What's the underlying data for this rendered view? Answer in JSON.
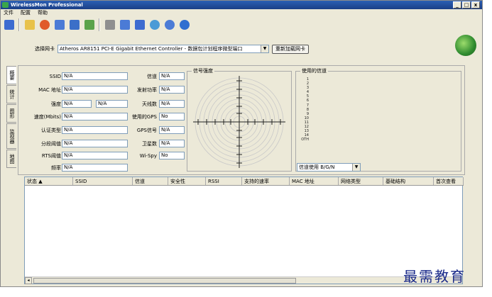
{
  "window": {
    "title": "WirelessMon Professional",
    "btn_min": "_",
    "btn_max": "□",
    "btn_close": "x"
  },
  "menu": [
    "文件",
    "配置",
    "帮助"
  ],
  "toolbar": {
    "icons": [
      "save-icon",
      "open-folder-icon",
      "record-icon",
      "network-icon",
      "log-icon",
      "export-icon",
      "print-icon",
      "chart-icon",
      "info-icon",
      "globe-icon",
      "refresh-icon",
      "help-icon"
    ],
    "colors": [
      "#3d6bd0",
      "#e8c24a",
      "#e05a2a",
      "#4b7bd6",
      "#3b6fc8",
      "#5aa34a",
      "#8f8f8f",
      "#4b7bd6",
      "#3d6bd0",
      "#4b9bd6",
      "#4b7bd6",
      "#2f6fd0"
    ]
  },
  "adapter": {
    "label": "选择网卡",
    "value": "Atheros AR8151 PCI-E Gigabit Ethernet Controller - 数据包计划程序微型端口",
    "reload": "重新加载网卡"
  },
  "tabs": [
    "概要",
    "统计",
    "图形",
    "监视器",
    "地图"
  ],
  "fields_left": [
    {
      "label": "SSID",
      "value": "N/A"
    },
    {
      "label": "MAC 地址",
      "value": "N/A"
    },
    {
      "label": "强度",
      "value": "N/A",
      "value2": "N/A"
    },
    {
      "label": "速度(Mbits)",
      "value": "N/A"
    },
    {
      "label": "认证类型",
      "value": "N/A"
    },
    {
      "label": "分段阈值",
      "value": "N/A"
    },
    {
      "label": "RTS阈值",
      "value": "N/A"
    },
    {
      "label": "频率",
      "value": "N/A"
    }
  ],
  "fields_mid": [
    {
      "label": "信道",
      "value": "N/A"
    },
    {
      "label": "发射功率",
      "value": "N/A"
    },
    {
      "label": "天线数",
      "value": "N/A"
    },
    {
      "label": "使用的GPS",
      "value": "No"
    },
    {
      "label": "GPS信号",
      "value": "N/A"
    },
    {
      "label": "卫星数",
      "value": "N/A"
    },
    {
      "label": "Wi-Spy",
      "value": "No"
    }
  ],
  "signal_group": {
    "title": "信号强度"
  },
  "channel_group": {
    "title": "使用的信道",
    "channels": [
      "1",
      "2",
      "3",
      "4",
      "5",
      "6",
      "7",
      "8",
      "9",
      "10",
      "11",
      "12",
      "13",
      "14",
      "OTH"
    ],
    "filter": "信道使用 B/G/N"
  },
  "table": {
    "columns": [
      "状态 ▲",
      "SSID",
      "信道",
      "安全性",
      "RSSI",
      "支持的速率",
      "MAC 地址",
      "网络类型",
      "基础结构",
      "首次查看"
    ],
    "scroll_left": "◂"
  },
  "watermark": "最需教育"
}
